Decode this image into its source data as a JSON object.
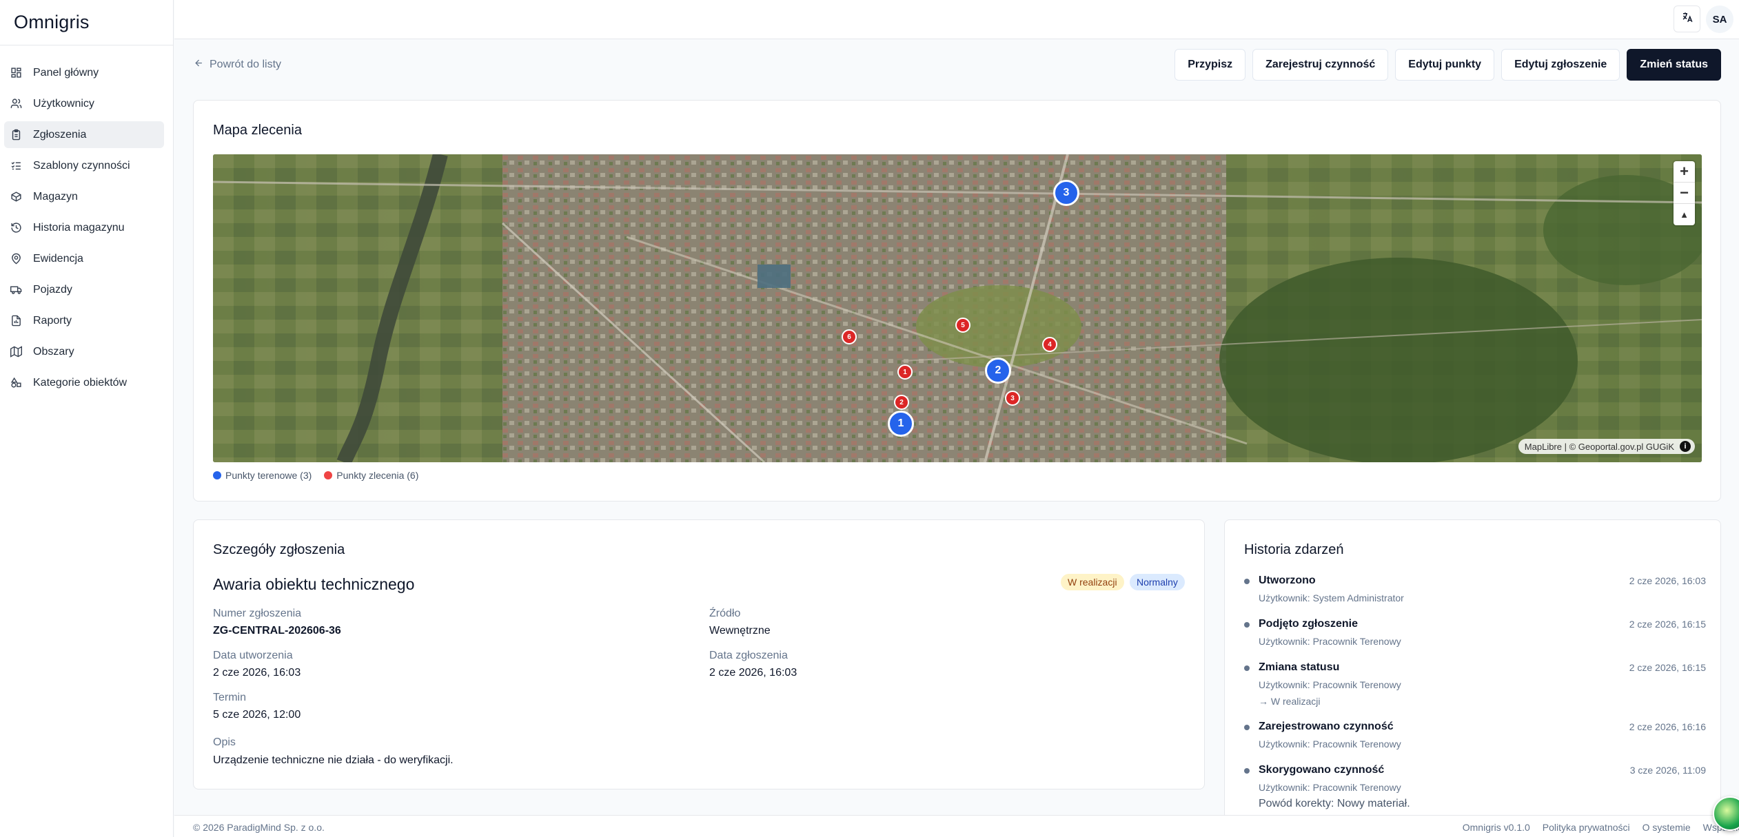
{
  "app": {
    "logo": "Omnigris"
  },
  "sidebar": {
    "items": [
      {
        "label": "Panel główny",
        "icon": "dashboard-icon"
      },
      {
        "label": "Użytkownicy",
        "icon": "users-icon"
      },
      {
        "label": "Zgłoszenia",
        "icon": "clipboard-icon",
        "active": true
      },
      {
        "label": "Szablony czynności",
        "icon": "list-check-icon"
      },
      {
        "label": "Magazyn",
        "icon": "package-icon"
      },
      {
        "label": "Historia magazynu",
        "icon": "history-icon"
      },
      {
        "label": "Ewidencja",
        "icon": "map-pin-icon"
      },
      {
        "label": "Pojazdy",
        "icon": "truck-icon"
      },
      {
        "label": "Raporty",
        "icon": "chart-icon"
      },
      {
        "label": "Obszary",
        "icon": "map-icon"
      },
      {
        "label": "Kategorie obiektów",
        "icon": "shapes-icon"
      }
    ]
  },
  "topbar": {
    "avatar_initials": "SA",
    "language_icon": "translate-icon"
  },
  "header": {
    "back_label": "Powrót do listy",
    "actions": {
      "assign": "Przypisz",
      "register_activity": "Zarejestruj czynność",
      "edit_points": "Edytuj punkty",
      "edit_ticket": "Edytuj zgłoszenie",
      "change_status": "Zmień status"
    }
  },
  "map": {
    "title": "Mapa zlecenia",
    "attribution": "MapLibre | © Geoportal.gov.pl GUGiK",
    "legend": {
      "field_points": "Punkty terenowe (3)",
      "order_points": "Punkty zlecenia (6)"
    },
    "colors": {
      "field_point": "#2563eb",
      "order_point": "#dc2626"
    },
    "field_points": [
      {
        "label": "1"
      },
      {
        "label": "2"
      },
      {
        "label": "3"
      }
    ],
    "order_points": [
      {
        "label": "1"
      },
      {
        "label": "2"
      },
      {
        "label": "3"
      },
      {
        "label": "4"
      },
      {
        "label": "5"
      },
      {
        "label": "6"
      }
    ]
  },
  "details": {
    "title": "Szczegóły zgłoszenia",
    "issue_title": "Awaria obiektu technicznego",
    "status_badge": "W realizacji",
    "priority_badge": "Normalny",
    "number_label": "Numer zgłoszenia",
    "number_value": "ZG-CENTRAL-202606-36",
    "source_label": "Źródło",
    "source_value": "Wewnętrzne",
    "created_label": "Data utworzenia",
    "created_value": "2 cze 2026, 16:03",
    "reported_label": "Data zgłoszenia",
    "reported_value": "2 cze 2026, 16:03",
    "deadline_label": "Termin",
    "deadline_value": "5 cze 2026, 12:00",
    "description_label": "Opis",
    "description_value": "Urządzenie techniczne nie działa - do weryfikacji."
  },
  "history": {
    "title": "Historia zdarzeń",
    "events": [
      {
        "title": "Utworzono",
        "time": "2 cze 2026, 16:03",
        "user": "Użytkownik: System Administrator",
        "extra": ""
      },
      {
        "title": "Podjęto zgłoszenie",
        "time": "2 cze 2026, 16:15",
        "user": "Użytkownik: Pracownik Terenowy",
        "extra": ""
      },
      {
        "title": "Zmiana statusu",
        "time": "2 cze 2026, 16:15",
        "user": "Użytkownik: Pracownik Terenowy",
        "extra": "→ W realizacji"
      },
      {
        "title": "Zarejestrowano czynność",
        "time": "2 cze 2026, 16:16",
        "user": "Użytkownik: Pracownik Terenowy",
        "extra": ""
      },
      {
        "title": "Skorygowano czynność",
        "time": "3 cze 2026, 11:09",
        "user": "Użytkownik: Pracownik Terenowy",
        "extra": "Powód korekty: Nowy materiał."
      }
    ]
  },
  "footer": {
    "copyright": "© 2026 ParadigMind Sp. z o.o.",
    "version": "Omnigris v0.1.0",
    "privacy": "Polityka prywatności",
    "about": "O systemie",
    "support": "Wsparcie"
  }
}
